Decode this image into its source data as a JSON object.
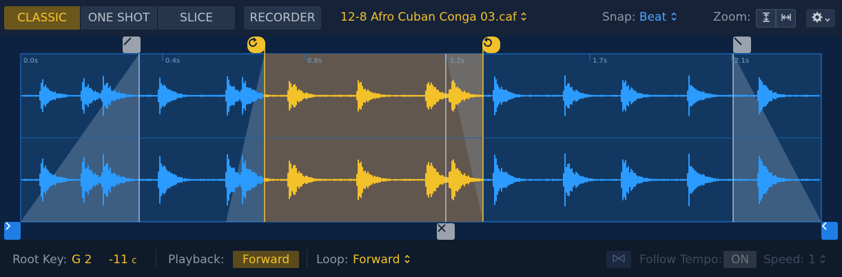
{
  "modes": {
    "classic": "CLASSIC",
    "one_shot": "ONE SHOT",
    "slice": "SLICE",
    "active": "classic"
  },
  "recorder_label": "RECORDER",
  "file": {
    "name": "12-8 Afro Cuban Conga 03.caf",
    "chevron": "⌃⌄"
  },
  "snap": {
    "label": "Snap:",
    "value": "Beat"
  },
  "zoom": {
    "label": "Zoom:"
  },
  "ruler_ticks": [
    "0.0s",
    "0.4s",
    "0.8s",
    "1.2s",
    "1.7s",
    "2.1s"
  ],
  "icons": {
    "zoom_vertical": "zoom-vertical-icon",
    "zoom_horizontal": "zoom-horizontal-icon",
    "settings": "gear-icon",
    "fade_in": "fade-in-handle-icon",
    "fade_out": "fade-out-handle-icon",
    "loop_start": "loop-start-icon",
    "loop_end": "loop-end-icon",
    "sample_start": "chevron-right-icon",
    "sample_end": "chevron-left-icon",
    "remove_loop": "close-icon",
    "crossfade": "crossfade-icon"
  },
  "colors": {
    "accent": "#f3c12a",
    "waveform": "#2c9bff",
    "snap_value": "#4fa6ff"
  },
  "bottom": {
    "root_key_label": "Root Key:",
    "root_key_value": "G 2",
    "tune_value": "-11",
    "tune_unit": "c",
    "playback_label": "Playback:",
    "playback_value": "Forward",
    "loop_label": "Loop:",
    "loop_value": "Forward",
    "follow_tempo_label": "Follow Tempo:",
    "follow_tempo_value": "ON",
    "speed_label": "Speed:",
    "speed_value": "1"
  }
}
